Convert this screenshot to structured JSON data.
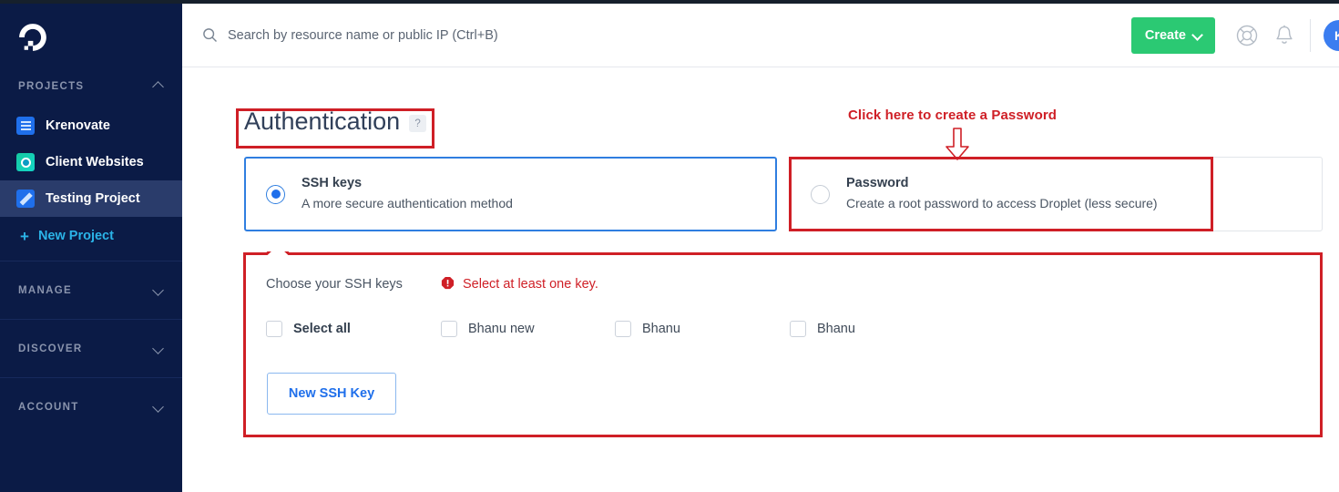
{
  "brand": {
    "logo_icon": "digitalocean-logo-icon",
    "accent_blue": "#1f6feb",
    "green": "#2bc973",
    "annotation_red": "#cf1f26",
    "sidebar_bg": "#0b1b46"
  },
  "sidebar": {
    "projects_section": {
      "label": "PROJECTS",
      "chevron_icon": "chevron-up-icon",
      "items": [
        {
          "label": "Krenovate",
          "icon": "project-list-icon",
          "active": false
        },
        {
          "label": "Client Websites",
          "icon": "project-circle-icon",
          "active": false
        },
        {
          "label": "Testing Project",
          "icon": "project-pencil-icon",
          "active": true
        }
      ],
      "new_project_label": "New Project",
      "new_project_icon": "plus-icon"
    },
    "groups": [
      {
        "label": "MANAGE",
        "chevron_icon": "chevron-down-icon"
      },
      {
        "label": "DISCOVER",
        "chevron_icon": "chevron-down-icon"
      },
      {
        "label": "ACCOUNT",
        "chevron_icon": "chevron-down-icon"
      }
    ]
  },
  "header": {
    "search": {
      "icon": "search-icon",
      "placeholder": "Search by resource name or public IP (Ctrl+B)",
      "value": ""
    },
    "create_label": "Create",
    "create_chevron_icon": "chevron-down-icon",
    "help_icon": "lifebuoy-help-icon",
    "notifications_icon": "bell-icon",
    "avatar_initial": "K"
  },
  "main": {
    "section_title": "Authentication",
    "help_badge": "?",
    "auth_options": [
      {
        "title": "SSH keys",
        "subtitle": "A more secure authentication method",
        "selected": true
      },
      {
        "title": "Password",
        "subtitle": "Create a root password to access Droplet (less secure)",
        "selected": false
      }
    ],
    "ssh_panel": {
      "label": "Choose your SSH keys",
      "error_icon": "error-octagon-icon",
      "error_text": "Select at least one key.",
      "checkboxes": [
        {
          "label": "Select all",
          "checked": false,
          "bold": true
        },
        {
          "label": "Bhanu new",
          "checked": false,
          "bold": false
        },
        {
          "label": "Bhanu",
          "checked": false,
          "bold": false
        },
        {
          "label": "Bhanu",
          "checked": false,
          "bold": false
        }
      ],
      "new_key_label": "New SSH Key"
    }
  },
  "annotations": {
    "callout_text": "Click here to create a Password",
    "arrow_icon": "down-arrow-outline-icon",
    "boxes": [
      "title-highlight",
      "password-option-highlight",
      "ssh-keys-panel-highlight"
    ]
  }
}
